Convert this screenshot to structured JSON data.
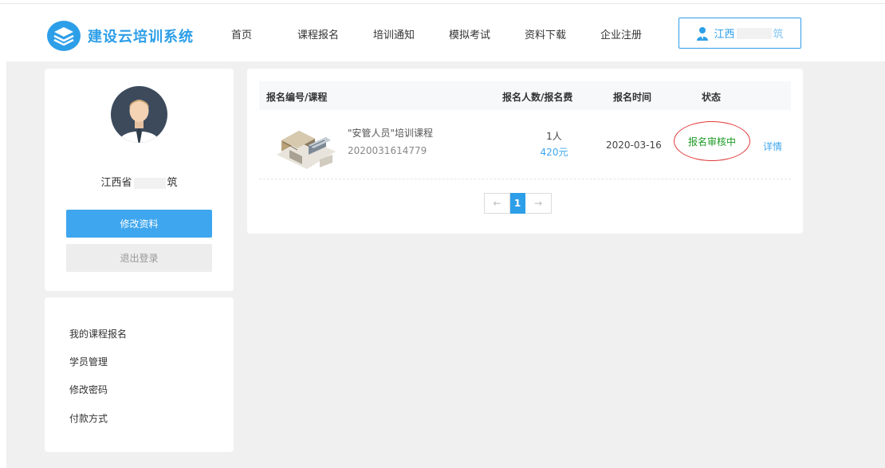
{
  "header": {
    "logo_text": "建设云培训系统",
    "nav": [
      "首页",
      "课程报名",
      "培训通知",
      "模拟考试",
      "资料下载",
      "企业注册"
    ],
    "user_label_start": "江西",
    "user_label_end": "筑"
  },
  "profile": {
    "name_start": "江西省",
    "name_end": "筑",
    "edit_button": "修改资料",
    "logout_button": "退出登录"
  },
  "menu": [
    "我的课程报名",
    "学员管理",
    "修改密码",
    "付款方式"
  ],
  "table": {
    "headers": {
      "course": "报名编号/课程",
      "count_fee": "报名人数/报名费",
      "time": "报名时间",
      "status": "状态"
    },
    "rows": [
      {
        "course_name": "\"安管人员\"培训课程",
        "course_id": "2020031614779",
        "count": "1人",
        "fee": "420元",
        "date": "2020-03-16",
        "status": "报名审核中",
        "action": "详情"
      }
    ]
  },
  "pagination": {
    "prev": "←",
    "current": "1",
    "next": "→"
  },
  "colors": {
    "accent": "#2d9ee8",
    "status_text": "#1c9a24",
    "status_circle": "#e23a3a"
  }
}
